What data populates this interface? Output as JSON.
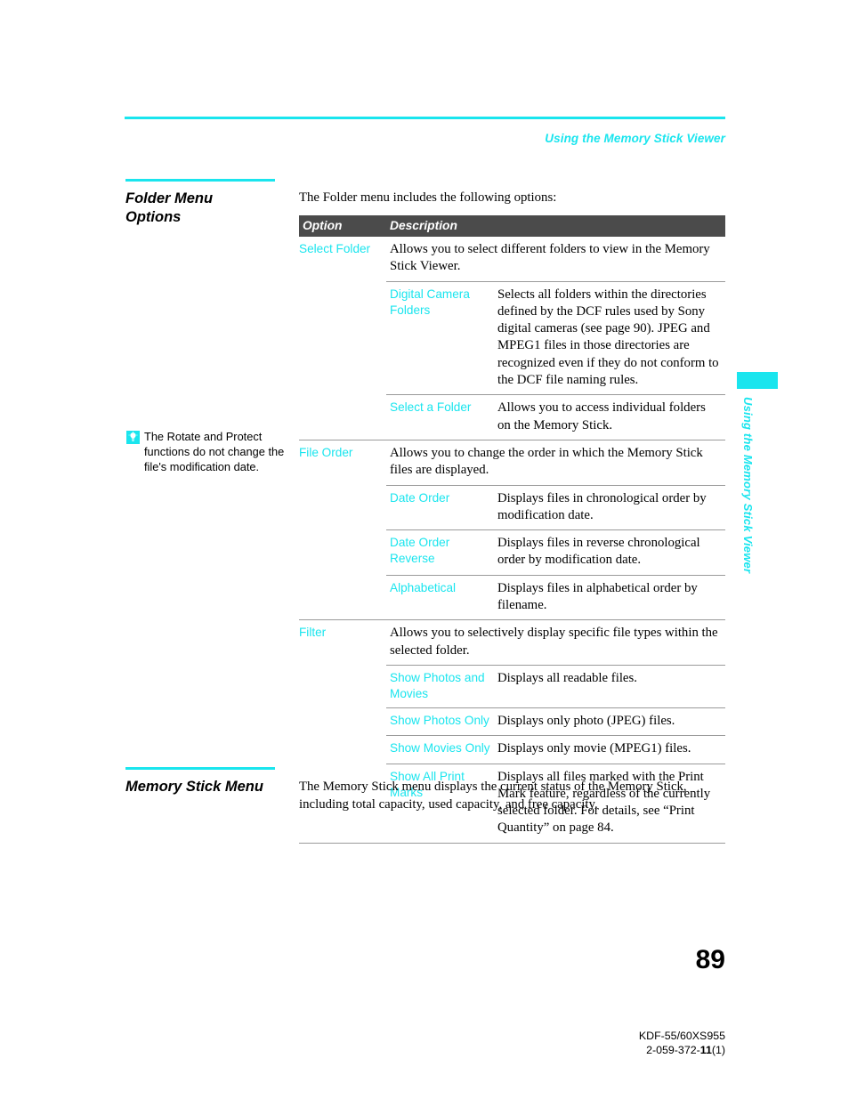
{
  "header": {
    "running_head": "Using the Memory Stick Viewer",
    "rule_color": "#1ae5ee"
  },
  "sections": {
    "folder_menu": {
      "title_line1": "Folder Menu",
      "title_line2": "Options",
      "intro": "The Folder menu includes the following options:"
    },
    "memory_stick_menu": {
      "title_line1": "Memory Stick Menu",
      "title_line2": "",
      "intro": "The Memory Stick menu displays the current status of the Memory Stick, including total capacity, used capacity, and free capacity."
    }
  },
  "tip_note": {
    "icon": "lightbulb-icon",
    "text": "The Rotate and Protect functions do not change the file's modification date."
  },
  "options_table": {
    "columns": {
      "option": "Option",
      "description": "Description"
    },
    "rows": [
      {
        "type": "option",
        "name": "Select Folder",
        "description": "Allows you to select different folders to view in the Memory Stick Viewer."
      },
      {
        "type": "sub",
        "name": "Digital Camera Folders",
        "description": "Selects all folders within the directories defined by the DCF rules used by Sony digital cameras (see page 90). JPEG and MPEG1 files in those directories are recognized even if they do not conform to the DCF file naming rules."
      },
      {
        "type": "sub",
        "name": "Select a Folder",
        "description": "Allows you to access individual folders on the Memory Stick."
      },
      {
        "type": "option",
        "name": "File Order",
        "description": "Allows you to change the order in which the Memory Stick files are displayed."
      },
      {
        "type": "sub",
        "name": "Date Order",
        "description": "Displays files in chronological order by modification date."
      },
      {
        "type": "sub",
        "name": "Date Order Reverse",
        "description": "Displays files in reverse chronological order by modification date."
      },
      {
        "type": "sub",
        "name": "Alphabetical",
        "description": "Displays files in alphabetical order by filename."
      },
      {
        "type": "option",
        "name": "Filter",
        "description": "Allows you to selectively display specific file types within the selected folder."
      },
      {
        "type": "sub",
        "name": "Show Photos and Movies",
        "description": "Displays all readable files."
      },
      {
        "type": "sub",
        "name": "Show Photos Only",
        "description": "Displays only photo (JPEG) files."
      },
      {
        "type": "sub",
        "name": "Show Movies Only",
        "description": "Displays only movie (MPEG1) files."
      },
      {
        "type": "sub",
        "name": "Show All Print Marks",
        "description": "Displays all files marked with the Print Mark feature, regardless of the currently selected folder. For details, see “Print Quantity” on page 84."
      }
    ]
  },
  "side_tab": {
    "label": "Using the Memory Stick Viewer"
  },
  "page_number": "89",
  "footer": {
    "model": "KDF-55/60XS955",
    "doc_number_prefix": "2-059-372-",
    "doc_number_bold": "11",
    "doc_number_suffix": "(1)"
  }
}
